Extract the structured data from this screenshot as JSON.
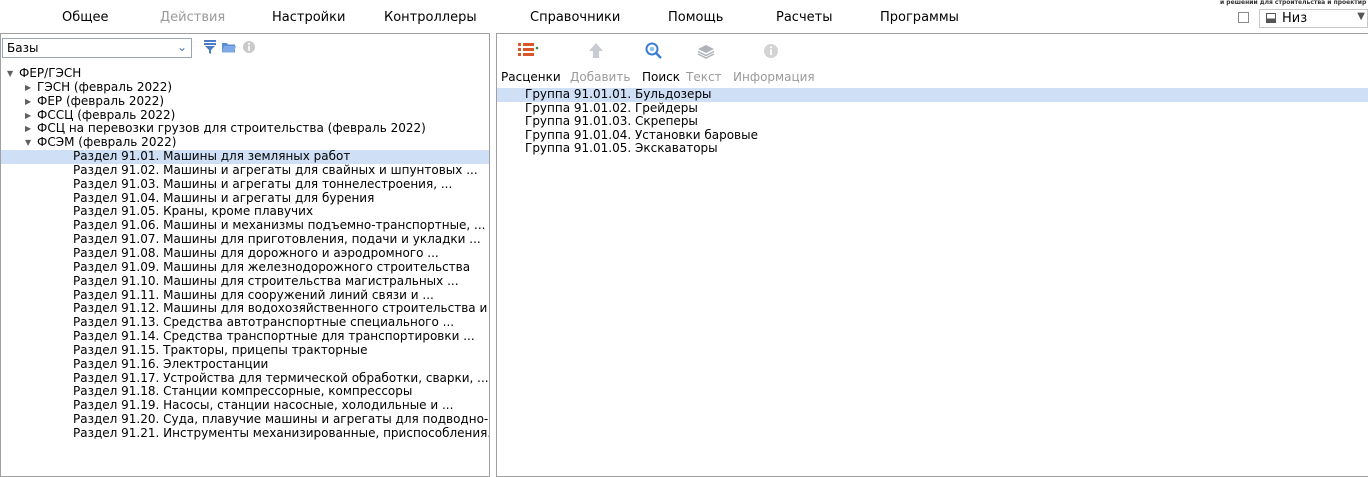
{
  "menu": {
    "items": [
      "Общее",
      "Действия",
      "Настройки",
      "Контроллеры",
      "Справочники",
      "Помощь",
      "Расчеты",
      "Программы"
    ],
    "disabled": [
      false,
      true,
      false,
      false,
      false,
      false,
      false,
      false
    ]
  },
  "brand_text": "и решений для строительства и проектир",
  "view": {
    "selected": "Низ",
    "icon": "panel-bottom-icon"
  },
  "left": {
    "base_select": "Базы",
    "icons": [
      "chevron-down-icon",
      "filter-icon",
      "folder-open-icon",
      "info-icon"
    ],
    "tree": [
      {
        "label": "ФЕР/ГЭСН",
        "level": 0,
        "expanded": true
      },
      {
        "label": "ГЭСН (февраль 2022)",
        "level": 1,
        "expanded": false
      },
      {
        "label": "ФЕР (февраль 2022)",
        "level": 1,
        "expanded": false
      },
      {
        "label": "ФССЦ (февраль 2022)",
        "level": 1,
        "expanded": false
      },
      {
        "label": "ФСЦ на перевозки грузов для строительства (февраль 2022)",
        "level": 1,
        "expanded": false
      },
      {
        "label": "ФСЭМ (февраль 2022)",
        "level": 1,
        "expanded": true
      },
      {
        "label": "Раздел 91.01. Машины для земляных работ",
        "level": 2,
        "selected": true
      },
      {
        "label": "Раздел 91.02. Машины и агрегаты для свайных и шпунтовых ...",
        "level": 2
      },
      {
        "label": "Раздел 91.03. Машины и агрегаты для тоннелестроения, ...",
        "level": 2
      },
      {
        "label": "Раздел 91.04. Машины и агрегаты для бурения",
        "level": 2
      },
      {
        "label": "Раздел 91.05. Краны, кроме плавучих",
        "level": 2
      },
      {
        "label": "Раздел 91.06. Машины и механизмы подъемно-транспортные, ...",
        "level": 2
      },
      {
        "label": "Раздел 91.07. Машины для приготовления, подачи и укладки ...",
        "level": 2
      },
      {
        "label": "Раздел 91.08. Машины для дорожного и аэродромного ...",
        "level": 2
      },
      {
        "label": "Раздел 91.09. Машины для железнодорожного строительства",
        "level": 2
      },
      {
        "label": "Раздел 91.10. Машины для строительства магистральных ...",
        "level": 2
      },
      {
        "label": "Раздел 91.11. Машины для сооружений линий связи и ...",
        "level": 2
      },
      {
        "label": "Раздел 91.12. Машины для водохозяйственного строительства и ...",
        "level": 2
      },
      {
        "label": "Раздел 91.13. Средства автотранспортные специального ...",
        "level": 2
      },
      {
        "label": "Раздел 91.14. Средства транспортные для транспортировки ...",
        "level": 2
      },
      {
        "label": "Раздел 91.15. Тракторы, прицепы тракторные",
        "level": 2
      },
      {
        "label": "Раздел 91.16. Электростанции",
        "level": 2
      },
      {
        "label": "Раздел 91.17. Устройства для термической обработки, сварки, ...",
        "level": 2
      },
      {
        "label": "Раздел 91.18. Станции компрессорные, компрессоры",
        "level": 2
      },
      {
        "label": "Раздел 91.19. Насосы, станции насосные, холодильные и ...",
        "level": 2
      },
      {
        "label": "Раздел 91.20. Суда, плавучие машины и агрегаты для подводно-...",
        "level": 2
      },
      {
        "label": "Раздел 91.21. Инструменты механизированные, приспособления...",
        "level": 2
      }
    ]
  },
  "right": {
    "toolbar": [
      {
        "label": "Расценки",
        "icon": "list-icon",
        "disabled": false
      },
      {
        "label": "Добавить",
        "icon": "arrow-up-icon",
        "disabled": true
      },
      {
        "label": "Поиск",
        "icon": "search-icon",
        "disabled": false
      },
      {
        "label": "Текст",
        "icon": "layers-icon",
        "disabled": true
      },
      {
        "label": "Информация",
        "icon": "info-icon",
        "disabled": true
      }
    ],
    "list": [
      {
        "label": "Группа 91.01.01. Бульдозеры",
        "selected": true
      },
      {
        "label": "Группа 91.01.02. Грейдеры"
      },
      {
        "label": "Группа 91.01.03. Скреперы"
      },
      {
        "label": "Группа 91.01.04. Установки баровые"
      },
      {
        "label": "Группа 91.01.05. Экскаваторы"
      }
    ]
  }
}
